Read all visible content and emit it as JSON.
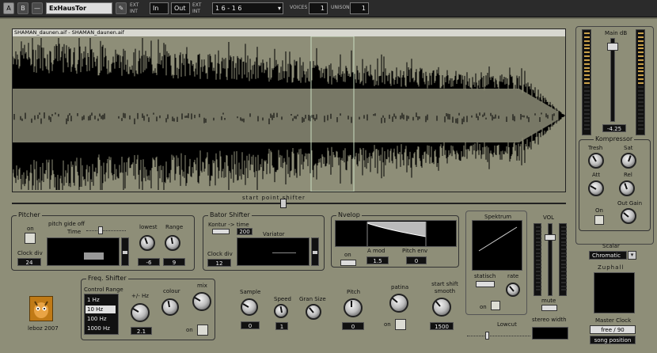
{
  "toolbar": {
    "btn_a": "A",
    "btn_b": "B",
    "title": "ExHausTor",
    "in_select": "In",
    "out_select": "Out",
    "ext_label": "EXT",
    "int_label": "INT",
    "midi_range": "1 6 - 1 6",
    "voices_label": "VOICES",
    "voices_value": "1",
    "unison_label": "UNISON",
    "unison_value": "1"
  },
  "waveform": {
    "title": "SHAMAN_daunen.aif - SHAMAN_daunen.aif",
    "start_shifter_label": "start point shifter"
  },
  "master": {
    "main_db_label": "Main dB",
    "main_db_value": "-4.25",
    "kompressor_label": "Kompressor",
    "thresh_label": "Tresh",
    "sat_label": "Sat",
    "att_label": "Att",
    "rel_label": "Rel",
    "on_label": "On",
    "out_gain_label": "Out Gain"
  },
  "pitcher": {
    "title": "Pitcher",
    "on_label": "on",
    "glide_label": "pitch gide off",
    "time_label": "Time",
    "lowest_label": "lowest",
    "range_label": "Range",
    "clock_div_label": "Clock div",
    "clock_div_value": "24",
    "lowest_value": "-6",
    "range_value": "9"
  },
  "bator": {
    "title": "Bator Shifter",
    "kontur_label": "Kontur -> time",
    "time_value": "200",
    "variator_label": "Variator",
    "clock_div_label": "Clock div",
    "clock_div_value": "12"
  },
  "nvelop": {
    "title": "Nvelop",
    "on_label": "on",
    "a_mod_label": "A mod",
    "a_mod_value": "1.5",
    "pitch_env_label": "Pitch env",
    "pitch_env_value": "0"
  },
  "spektrum": {
    "title": "Spektrum",
    "statisch_label": "statisch",
    "rate_label": "rate",
    "on_label": "on"
  },
  "vol": {
    "label": "VOL",
    "mute_label": "mute",
    "stereo_width_label": "stereo width"
  },
  "scalar": {
    "label": "Scalar",
    "value": "Chromatic",
    "zuphall_label": "Zuphall",
    "master_clock_label": "Master Clock",
    "master_clock_value": "free / 90",
    "song_position_label": "song position"
  },
  "freq": {
    "title": "Freq. Shifter",
    "control_range_label": "Control Range",
    "options": [
      "1 Hz",
      "10 Hz",
      "100 Hz",
      "1000 Hz"
    ],
    "hz_label": "+/- Hz",
    "hz_value": "2.1",
    "colour_label": "colour",
    "mix_label": "mix",
    "on_label": "on"
  },
  "bottom": {
    "sample_label": "Sample",
    "sample_value": "0",
    "speed_label": "Speed",
    "speed_value": "1",
    "gran_size_label": "Gran Size",
    "pitch_label": "Pitch",
    "pitch_value": "0",
    "patina_label": "patina",
    "on_label": "on",
    "start_shift_smooth_label": "start shift smooth",
    "start_shift_smooth_value": "1500",
    "lowcut_label": "Lowcut"
  },
  "branding": {
    "credit": "leboz 2007"
  }
}
